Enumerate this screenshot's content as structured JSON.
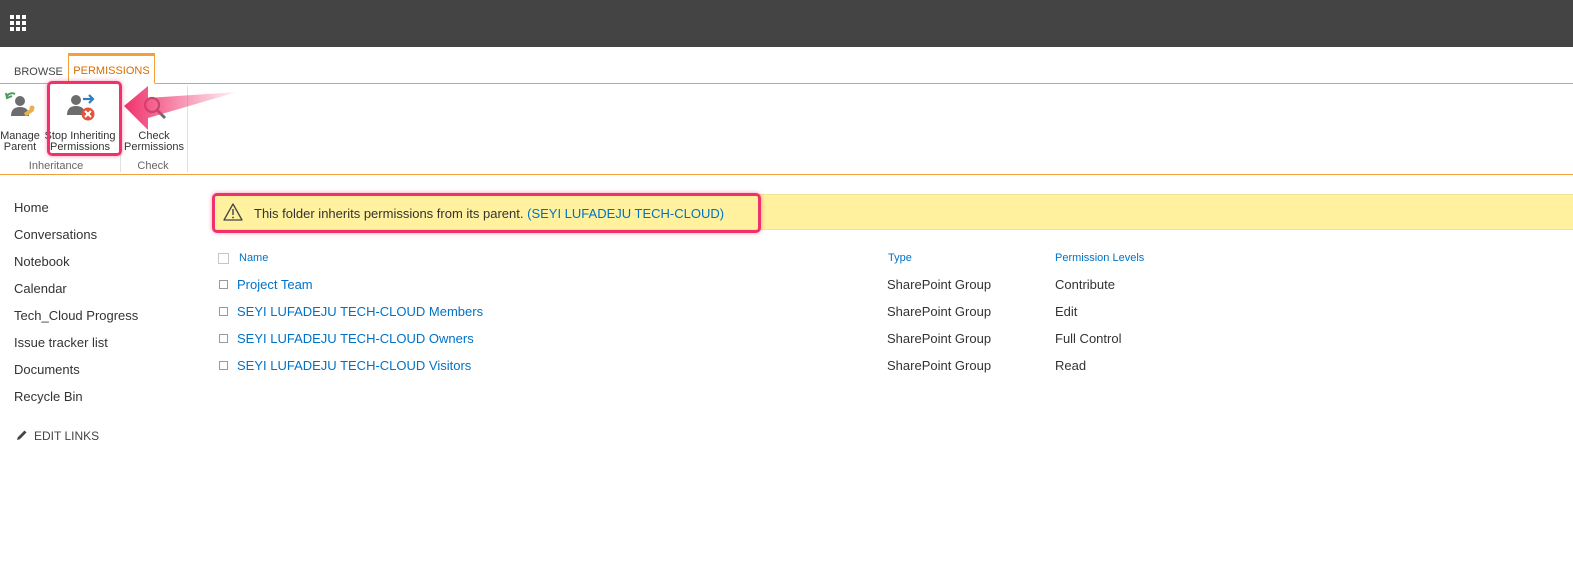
{
  "icons": {
    "app_launcher": "waffle-icon",
    "manage_parent": "manage-parent-icon",
    "stop_inheriting": "stop-inheriting-icon",
    "check_permissions": "check-permissions-icon",
    "warning": "warning-icon",
    "edit": "pencil-icon"
  },
  "colors": {
    "topbar": "#444444",
    "accent": "#f2a039",
    "active_tab_text": "#d86c00",
    "link": "#0072c6",
    "notice_bg": "#fff19d",
    "highlight": "#f0326c"
  },
  "tabs": {
    "browse": "BROWSE",
    "permissions": "PERMISSIONS"
  },
  "ribbon": {
    "manage_parent": {
      "line1": "Manage",
      "line2": "Parent"
    },
    "stop_inheriting": {
      "line1": "Stop Inheriting",
      "line2": "Permissions"
    },
    "check_permissions": {
      "line1": "Check",
      "line2": "Permissions"
    },
    "groups": {
      "inheritance": "Inheritance",
      "check": "Check"
    }
  },
  "leftnav": {
    "items": [
      "Home",
      "Conversations",
      "Notebook",
      "Calendar",
      "Tech_Cloud Progress",
      "Issue tracker list",
      "Documents",
      "Recycle Bin"
    ],
    "edit_links": "EDIT LINKS"
  },
  "notice": {
    "text": "This folder inherits permissions from its parent.",
    "link": "(SEYI LUFADEJU TECH-CLOUD)"
  },
  "table": {
    "headers": {
      "name": "Name",
      "type": "Type",
      "permission": "Permission Levels"
    },
    "rows": [
      {
        "name": "Project Team",
        "type": "SharePoint Group",
        "permission": "Contribute"
      },
      {
        "name": "SEYI LUFADEJU TECH-CLOUD Members",
        "type": "SharePoint Group",
        "permission": "Edit"
      },
      {
        "name": "SEYI LUFADEJU TECH-CLOUD Owners",
        "type": "SharePoint Group",
        "permission": "Full Control"
      },
      {
        "name": "SEYI LUFADEJU TECH-CLOUD Visitors",
        "type": "SharePoint Group",
        "permission": "Read"
      }
    ]
  }
}
